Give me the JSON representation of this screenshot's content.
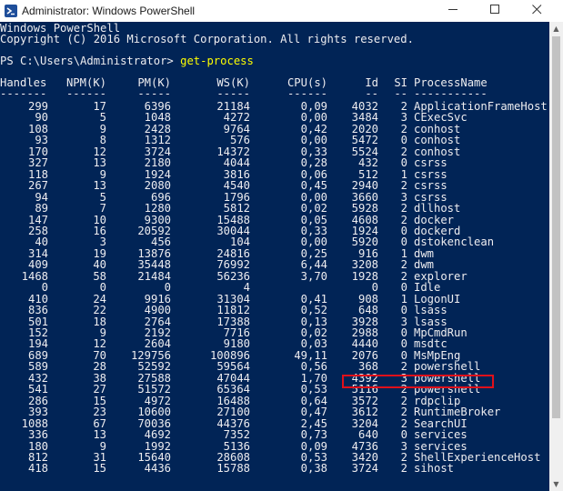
{
  "window": {
    "title": "Administrator: Windows PowerShell"
  },
  "header_lines": [
    "Windows PowerShell",
    "Copyright (C) 2016 Microsoft Corporation. All rights reserved."
  ],
  "prompt": {
    "text": "PS C:\\Users\\Administrator> ",
    "command": "get-process"
  },
  "table": {
    "columns": [
      "Handles",
      "NPM(K)",
      "PM(K)",
      "WS(K)",
      "CPU(s)",
      "Id",
      "SI",
      "ProcessName"
    ],
    "separators": [
      "-------",
      "------",
      "-----",
      "-----",
      "------",
      "--",
      "--",
      "-----------"
    ],
    "rows": [
      [
        "299",
        "17",
        "6396",
        "21184",
        "0,09",
        "4032",
        "2",
        "ApplicationFrameHost"
      ],
      [
        "90",
        "5",
        "1048",
        "4272",
        "0,00",
        "3484",
        "3",
        "CExecSvc"
      ],
      [
        "108",
        "9",
        "2428",
        "9764",
        "0,42",
        "2020",
        "2",
        "conhost"
      ],
      [
        "93",
        "8",
        "1312",
        "576",
        "0,00",
        "5472",
        "0",
        "conhost"
      ],
      [
        "170",
        "12",
        "3724",
        "14372",
        "0,33",
        "5524",
        "2",
        "conhost"
      ],
      [
        "327",
        "13",
        "2180",
        "4044",
        "0,28",
        "432",
        "0",
        "csrss"
      ],
      [
        "118",
        "9",
        "1924",
        "3816",
        "0,06",
        "512",
        "1",
        "csrss"
      ],
      [
        "267",
        "13",
        "2080",
        "4540",
        "0,45",
        "2940",
        "2",
        "csrss"
      ],
      [
        "94",
        "5",
        "696",
        "1796",
        "0,00",
        "3660",
        "3",
        "csrss"
      ],
      [
        "89",
        "7",
        "1280",
        "5812",
        "0,02",
        "5928",
        "2",
        "dllhost"
      ],
      [
        "147",
        "10",
        "9300",
        "15488",
        "0,05",
        "4608",
        "2",
        "docker"
      ],
      [
        "258",
        "16",
        "20592",
        "30044",
        "0,33",
        "1924",
        "0",
        "dockerd"
      ],
      [
        "40",
        "3",
        "456",
        "104",
        "0,00",
        "5920",
        "0",
        "dstokenclean"
      ],
      [
        "314",
        "19",
        "13876",
        "24816",
        "0,25",
        "916",
        "1",
        "dwm"
      ],
      [
        "409",
        "40",
        "35448",
        "76992",
        "6,44",
        "3208",
        "2",
        "dwm"
      ],
      [
        "1468",
        "58",
        "21484",
        "56236",
        "3,70",
        "1928",
        "2",
        "explorer"
      ],
      [
        "0",
        "0",
        "0",
        "4",
        "",
        "0",
        "0",
        "Idle"
      ],
      [
        "410",
        "24",
        "9916",
        "31304",
        "0,41",
        "908",
        "1",
        "LogonUI"
      ],
      [
        "836",
        "22",
        "4900",
        "11812",
        "0,52",
        "648",
        "0",
        "lsass"
      ],
      [
        "501",
        "18",
        "2764",
        "17388",
        "0,13",
        "3928",
        "3",
        "lsass"
      ],
      [
        "152",
        "9",
        "2192",
        "7716",
        "0,02",
        "2988",
        "0",
        "MpCmdRun"
      ],
      [
        "194",
        "12",
        "2604",
        "9180",
        "0,03",
        "4440",
        "0",
        "msdtc"
      ],
      [
        "689",
        "70",
        "129756",
        "100896",
        "49,11",
        "2076",
        "0",
        "MsMpEng"
      ],
      [
        "589",
        "28",
        "52592",
        "59564",
        "0,56",
        "368",
        "2",
        "powershell"
      ],
      [
        "432",
        "38",
        "27588",
        "47044",
        "1,70",
        "4392",
        "3",
        "powershell"
      ],
      [
        "541",
        "27",
        "51572",
        "65364",
        "0,53",
        "5116",
        "2",
        "powershell"
      ],
      [
        "286",
        "15",
        "4972",
        "16488",
        "0,64",
        "3572",
        "2",
        "rdpclip"
      ],
      [
        "393",
        "23",
        "10600",
        "27100",
        "0,47",
        "3612",
        "2",
        "RuntimeBroker"
      ],
      [
        "1088",
        "67",
        "70036",
        "44376",
        "2,45",
        "3204",
        "2",
        "SearchUI"
      ],
      [
        "336",
        "13",
        "4692",
        "7352",
        "0,73",
        "640",
        "0",
        "services"
      ],
      [
        "180",
        "9",
        "1992",
        "5136",
        "0,09",
        "4736",
        "3",
        "services"
      ],
      [
        "812",
        "31",
        "15640",
        "28608",
        "0,53",
        "3420",
        "2",
        "ShellExperienceHost"
      ],
      [
        "418",
        "15",
        "4436",
        "15788",
        "0,38",
        "3724",
        "2",
        "sihost"
      ]
    ]
  },
  "highlight": {
    "row_index": 24,
    "color": "#e0101a"
  },
  "colors": {
    "console_bg": "#012456",
    "console_fg": "#eeedf0",
    "command_fg": "#ffff00"
  },
  "icons": {
    "app": "powershell-icon",
    "minimize": "minimize-icon",
    "maximize": "maximize-icon",
    "close": "close-icon"
  }
}
